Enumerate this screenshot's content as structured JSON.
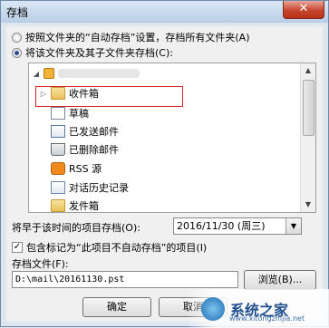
{
  "window": {
    "title": "存档",
    "close_glyph": "✕"
  },
  "options": {
    "radio_all": "按照文件夹的“自动存档”设置，存档所有文件夹(A)",
    "radio_selected": "将该文件夹及其子文件夹存档(C):"
  },
  "tree": {
    "items": [
      {
        "label": "收件箱",
        "icon": "inbox-folder-icon"
      },
      {
        "label": "草稿",
        "icon": "drafts-icon"
      },
      {
        "label": "已发送邮件",
        "icon": "sent-mail-icon"
      },
      {
        "label": "已删除邮件",
        "icon": "deleted-mail-icon"
      },
      {
        "label": "RSS 源",
        "icon": "rss-icon"
      },
      {
        "label": "对话历史记录",
        "icon": "conversation-history-icon"
      },
      {
        "label": "发件箱",
        "icon": "outbox-icon"
      }
    ]
  },
  "archive_date": {
    "label": "将早于该时间的项目存档(O):",
    "value": "2016/11/30 (周三)"
  },
  "include_checkbox": {
    "label": "包含标记为“此项目不自动存档”的项目(I)",
    "checked": true
  },
  "archive_file": {
    "label": "存档文件(F):",
    "value": "D:\\mail\\20161130.pst",
    "browse_label": "浏览(B)..."
  },
  "buttons": {
    "ok_label": "确定",
    "cancel_label": "取消"
  },
  "watermark": {
    "text": "系统之家",
    "sub": "www.xitongzhijia.net"
  }
}
